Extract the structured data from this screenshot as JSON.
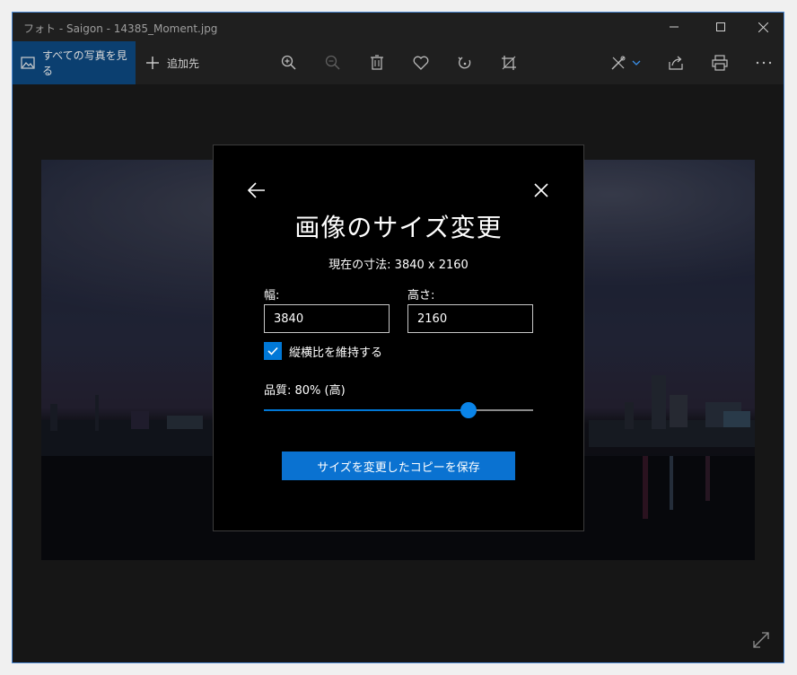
{
  "window": {
    "title": "フォト - Saigon - 14385_Moment.jpg"
  },
  "toolbar": {
    "all_photos_label": "すべての写真を見る",
    "add_label": "追加先"
  },
  "dialog": {
    "title": "画像のサイズ変更",
    "current_size": "現在の寸法: 3840 x 2160",
    "width_label": "幅:",
    "width_value": "3840",
    "height_label": "高さ:",
    "height_value": "2160",
    "keep_aspect_label": "縦横比を維持する",
    "keep_aspect_checked": true,
    "quality_label": "品質: 80% (高)",
    "quality_fraction": 0.76,
    "save_label": "サイズを変更したコピーを保存"
  },
  "colors": {
    "accent": "#0078d7",
    "selected_nav": "#0b3f70"
  },
  "icons": {
    "toolbar": [
      "zoom-in-icon",
      "zoom-out-icon",
      "delete-icon",
      "favorite-icon",
      "rotate-icon",
      "crop-icon",
      "edit-draw-icon",
      "share-icon",
      "print-icon",
      "more-icon"
    ]
  }
}
